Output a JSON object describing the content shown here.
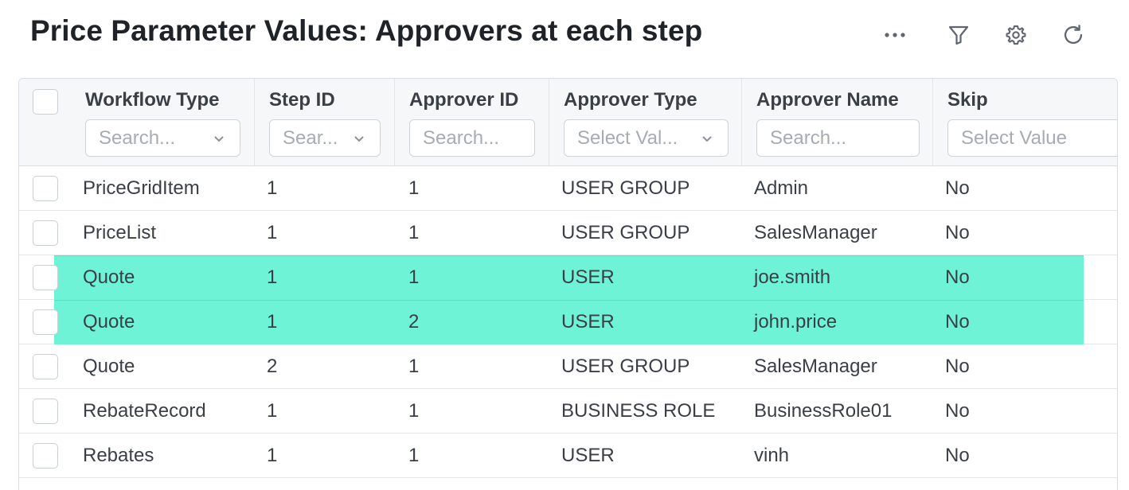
{
  "page": {
    "title": "Price Parameter Values: Approvers at each step"
  },
  "toolbar": {
    "more_icon": "ellipsis-icon",
    "filter_icon": "filter-icon",
    "settings_icon": "gear-icon",
    "refresh_icon": "refresh-icon"
  },
  "columns": [
    {
      "key": "workflow_type",
      "title": "Workflow Type",
      "filter_type": "select",
      "placeholder": "Search..."
    },
    {
      "key": "step_id",
      "title": "Step ID",
      "filter_type": "select",
      "placeholder": "Sear..."
    },
    {
      "key": "approver_id",
      "title": "Approver ID",
      "filter_type": "text",
      "placeholder": "Search..."
    },
    {
      "key": "approver_type",
      "title": "Approver Type",
      "filter_type": "select",
      "placeholder": "Select Val..."
    },
    {
      "key": "approver_name",
      "title": "Approver Name",
      "filter_type": "text",
      "placeholder": "Search..."
    },
    {
      "key": "skip",
      "title": "Skip",
      "filter_type": "select",
      "placeholder": "Select Value"
    }
  ],
  "rows": [
    {
      "workflow_type": "PriceGridItem",
      "step_id": "1",
      "approver_id": "1",
      "approver_type": "USER GROUP",
      "approver_name": "Admin",
      "skip": "No",
      "highlighted": false
    },
    {
      "workflow_type": "PriceList",
      "step_id": "1",
      "approver_id": "1",
      "approver_type": "USER GROUP",
      "approver_name": "SalesManager",
      "skip": "No",
      "highlighted": false
    },
    {
      "workflow_type": "Quote",
      "step_id": "1",
      "approver_id": "1",
      "approver_type": "USER",
      "approver_name": "joe.smith",
      "skip": "No",
      "highlighted": true
    },
    {
      "workflow_type": "Quote",
      "step_id": "1",
      "approver_id": "2",
      "approver_type": "USER",
      "approver_name": "john.price",
      "skip": "No",
      "highlighted": true
    },
    {
      "workflow_type": "Quote",
      "step_id": "2",
      "approver_id": "1",
      "approver_type": "USER GROUP",
      "approver_name": "SalesManager",
      "skip": "No",
      "highlighted": false
    },
    {
      "workflow_type": "RebateRecord",
      "step_id": "1",
      "approver_id": "1",
      "approver_type": "BUSINESS ROLE",
      "approver_name": "BusinessRole01",
      "skip": "No",
      "highlighted": false
    },
    {
      "workflow_type": "Rebates",
      "step_id": "1",
      "approver_id": "1",
      "approver_type": "USER",
      "approver_name": "vinh",
      "skip": "No",
      "highlighted": false
    }
  ],
  "colors": {
    "highlight": "#6ef3d6",
    "header_bg": "#f6f7f8",
    "border": "#d9dde2"
  }
}
